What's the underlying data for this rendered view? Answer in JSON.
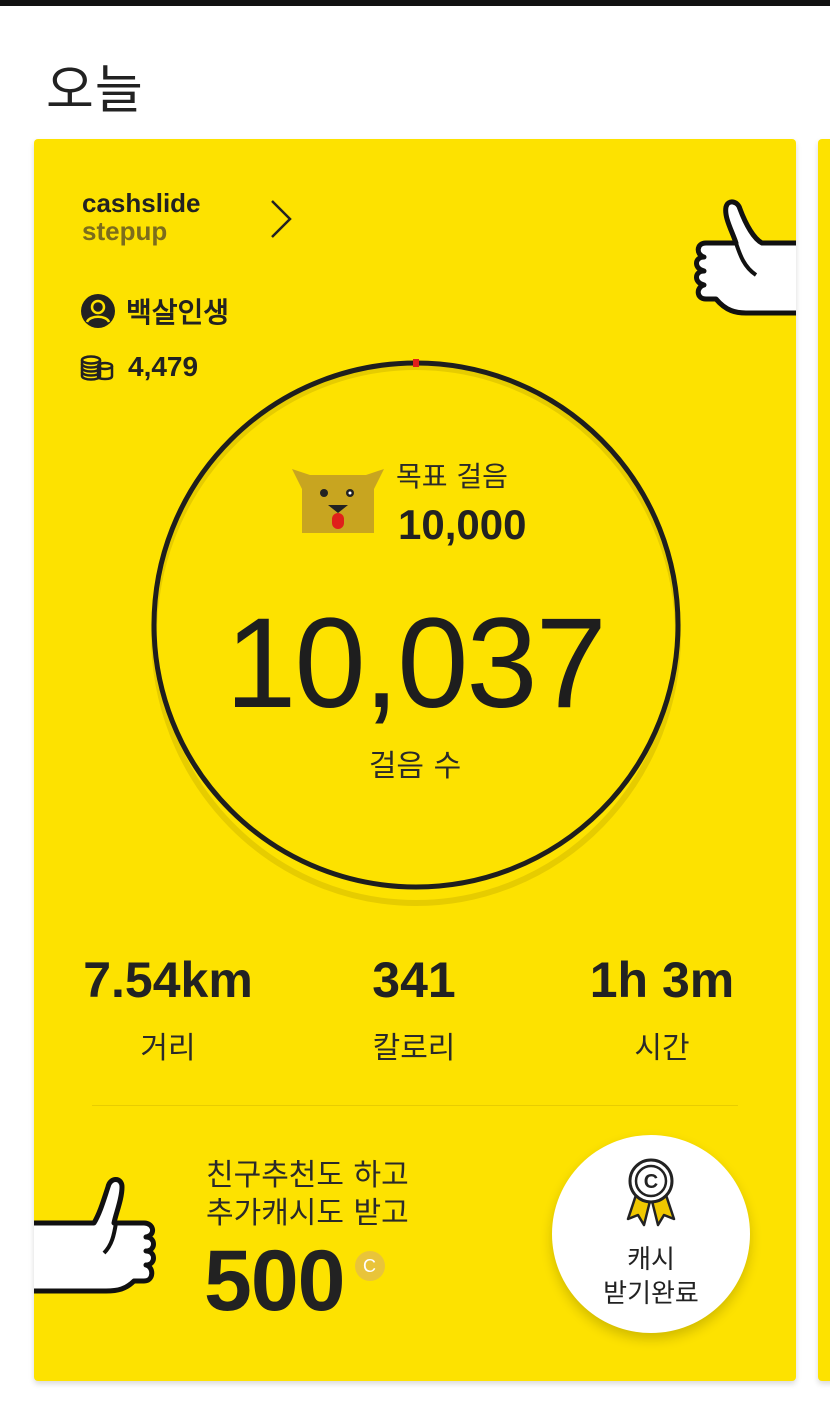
{
  "header": {
    "title": "오늘"
  },
  "card": {
    "brand": {
      "line1": "cashslide",
      "line2": "stepup"
    },
    "user": {
      "name": "백살인생",
      "coins": "4,479"
    },
    "goal": {
      "label": "목표 걸음",
      "value": "10,000"
    },
    "steps": {
      "value": "10,037",
      "label": "걸음 수",
      "progress_fraction": 1.0037
    },
    "stats": [
      {
        "value": "7.54km",
        "label": "거리"
      },
      {
        "value": "341",
        "label": "칼로리"
      },
      {
        "value": "1h 3m",
        "label": "시간"
      }
    ],
    "promo": {
      "line1": "친구추천도 하고",
      "line2": "추가캐시도 받고",
      "amount": "500",
      "currency_badge": "C"
    },
    "cash_button": {
      "line1": "캐시",
      "line2": "받기완료"
    }
  },
  "icons": {
    "chevron": "chevron-right-icon",
    "avatar": "user-avatar-icon",
    "coins": "coin-stack-icon",
    "mascot": "dog-mascot-icon",
    "thumb": "thumbs-up-icon",
    "medal": "medal-icon"
  },
  "colors": {
    "card_background": "#fde200",
    "ring": "#1e1e1e",
    "progress_marker": "#e0201a",
    "mascot": "#c8a520",
    "badge": "#e9c43a"
  }
}
